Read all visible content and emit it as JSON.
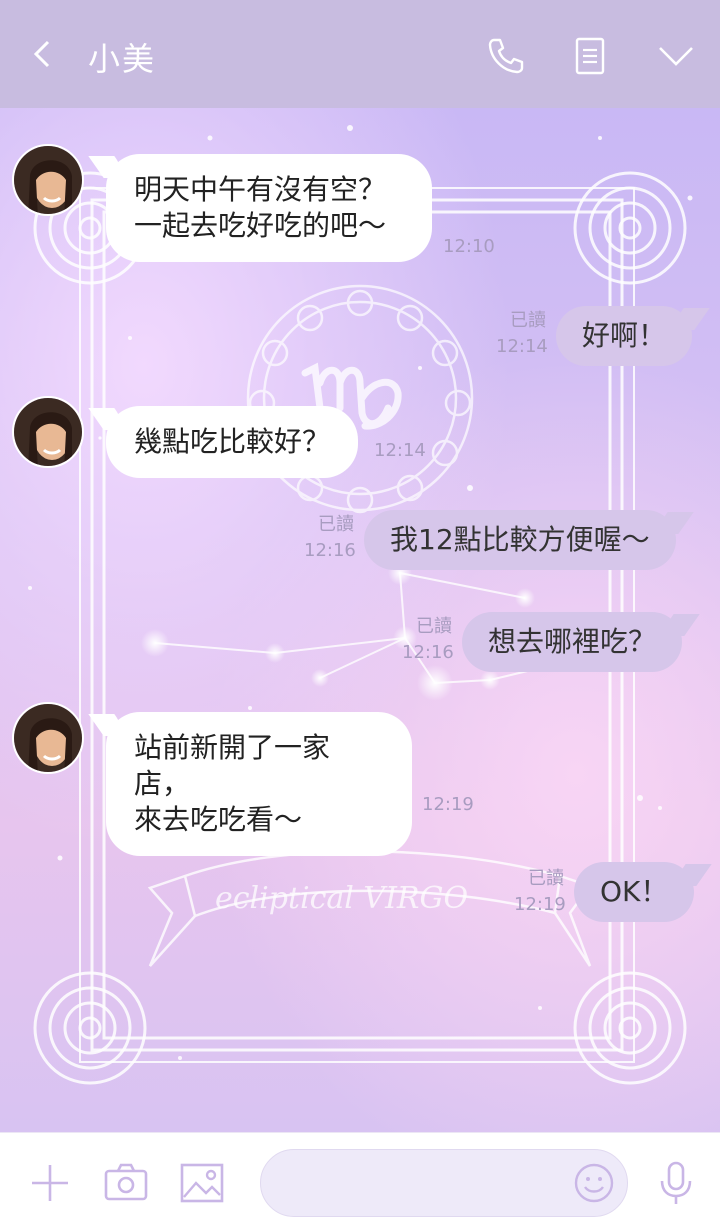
{
  "header": {
    "back_icon": "chevron-left-icon",
    "title": "小美",
    "icons": [
      "phone-icon",
      "notes-icon",
      "chevron-down-icon"
    ]
  },
  "messages": [
    {
      "dir": "in",
      "text": "明天中午有沒有空？\n一起去吃好吃的吧〜",
      "time": "12:10"
    },
    {
      "dir": "out",
      "text": "好啊！",
      "read": "已讀",
      "time": "12:14"
    },
    {
      "dir": "in",
      "text": "幾點吃比較好？",
      "time": "12:14"
    },
    {
      "dir": "out",
      "text": "我12點比較方便喔〜",
      "read": "已讀",
      "time": "12:16"
    },
    {
      "dir": "out",
      "text": "想去哪裡吃？",
      "read": "已讀",
      "time": "12:16"
    },
    {
      "dir": "in",
      "text": "站前新開了一家店，\n來去吃吃看〜",
      "time": "12:19"
    },
    {
      "dir": "out",
      "text": "OK！",
      "read": "已讀",
      "time": "12:19"
    }
  ],
  "background": {
    "ribbon_text": "ecliptical  VIRGO",
    "sign": "virgo-sign-icon"
  },
  "footer": {
    "icons": [
      "plus-icon",
      "camera-icon",
      "image-icon",
      "emoji-icon",
      "microphone-icon"
    ],
    "input_placeholder": ""
  },
  "colors": {
    "header_bg": "#c8bce0",
    "incoming_bubble": "#ffffff",
    "outgoing_bubble": "#d6c6ea",
    "meta_text": "#a89cc0",
    "footer_icon": "#c9b6e6"
  }
}
